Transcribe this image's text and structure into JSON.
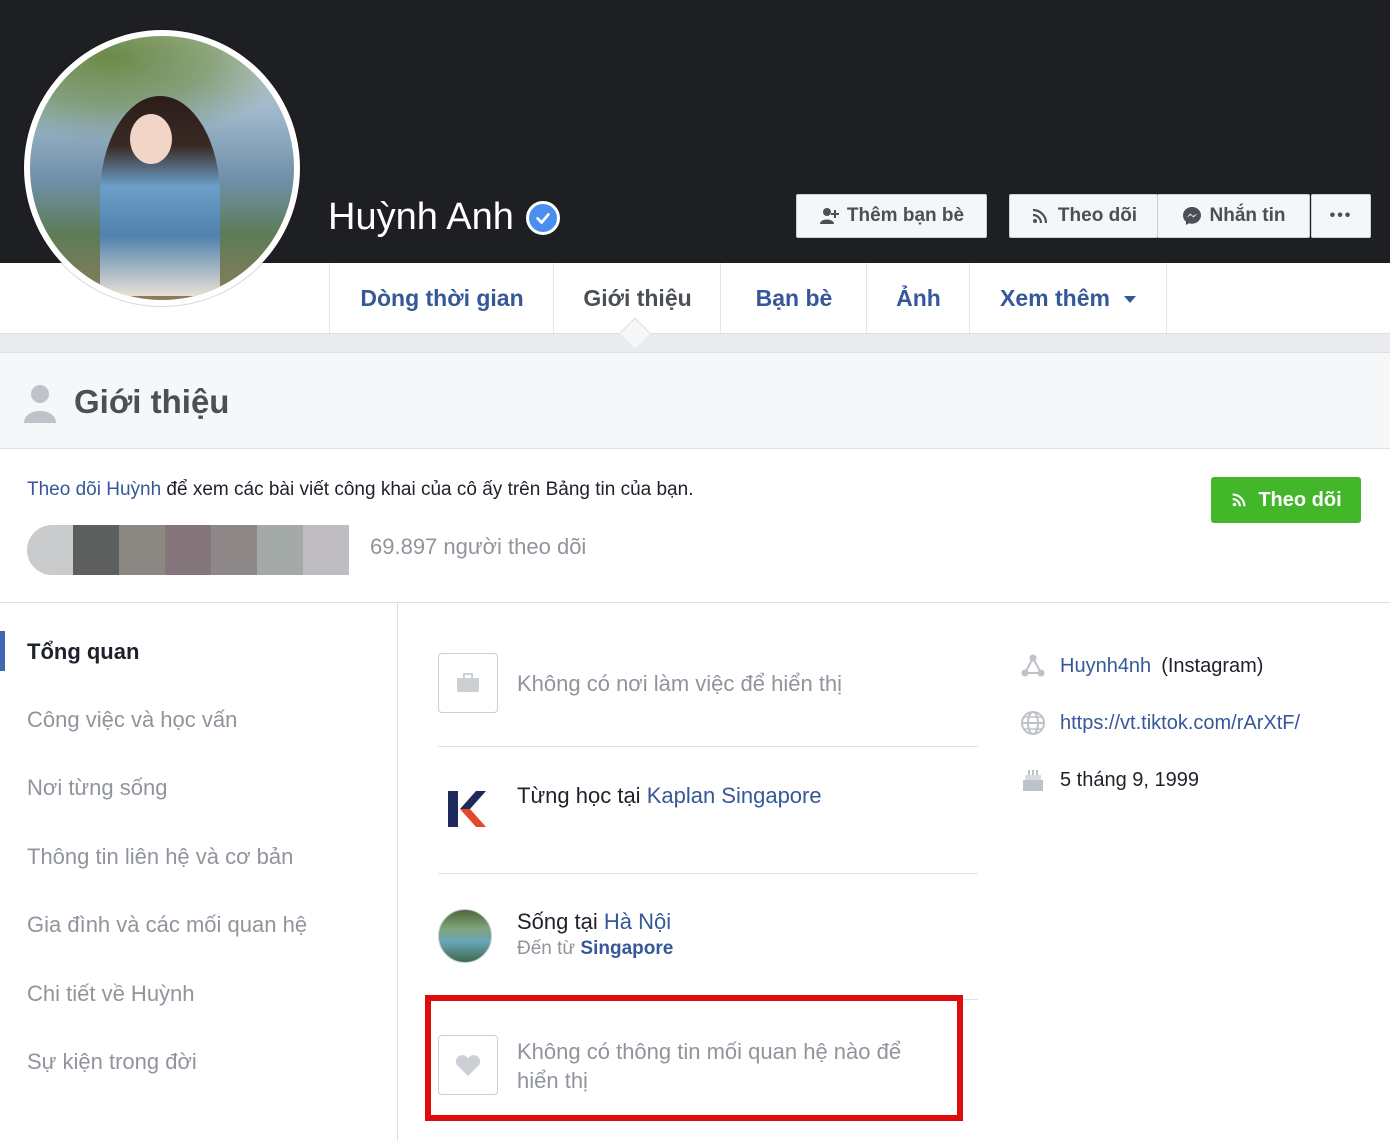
{
  "profile": {
    "name": "Huỳnh Anh"
  },
  "cover_buttons": {
    "add_friend": "Thêm bạn bè",
    "follow": "Theo dõi",
    "message": "Nhắn tin",
    "more": "•••"
  },
  "nav": {
    "tabs": [
      "Dòng thời gian",
      "Giới thiệu",
      "Bạn bè",
      "Ảnh",
      "Xem thêm"
    ],
    "active_tab": "Giới thiệu"
  },
  "about": {
    "title": "Giới thiệu",
    "follow_prompt": {
      "link": "Theo dõi Huỳnh",
      "rest": " để xem các bài viết công khai của cô ấy trên Bảng tin của bạn."
    },
    "follow_button": "Theo dõi",
    "follower_count": "69.897 người theo dõi"
  },
  "sidebar": {
    "items": [
      "Tổng quan",
      "Công việc và học vấn",
      "Nơi từng sống",
      "Thông tin liên hệ và cơ bản",
      "Gia đình và các mối quan hệ",
      "Chi tiết về Huỳnh",
      "Sự kiện trong đời"
    ],
    "active": "Tổng quan"
  },
  "overview": {
    "work": "Không có nơi làm việc để hiển thị",
    "education": {
      "prefix": "Từng học tại ",
      "school": "Kaplan Singapore"
    },
    "lives": {
      "prefix": "Sống tại ",
      "city": "Hà Nội",
      "from_prefix": "Đến từ ",
      "from": "Singapore"
    },
    "relationship_line1": "Không có thông tin mối quan hệ nào để",
    "relationship_line2": "hiển thị"
  },
  "contact": {
    "instagram_handle": "Huynh4nh",
    "instagram_label": "(Instagram)",
    "website": "https://vt.tiktok.com/rArXtF/",
    "birthday": "5 tháng 9, 1999"
  },
  "colors": {
    "cover_bg": "#1d1f23",
    "link": "#365899",
    "follow_green": "#42b72a",
    "highlight_red": "#e00b0b"
  }
}
